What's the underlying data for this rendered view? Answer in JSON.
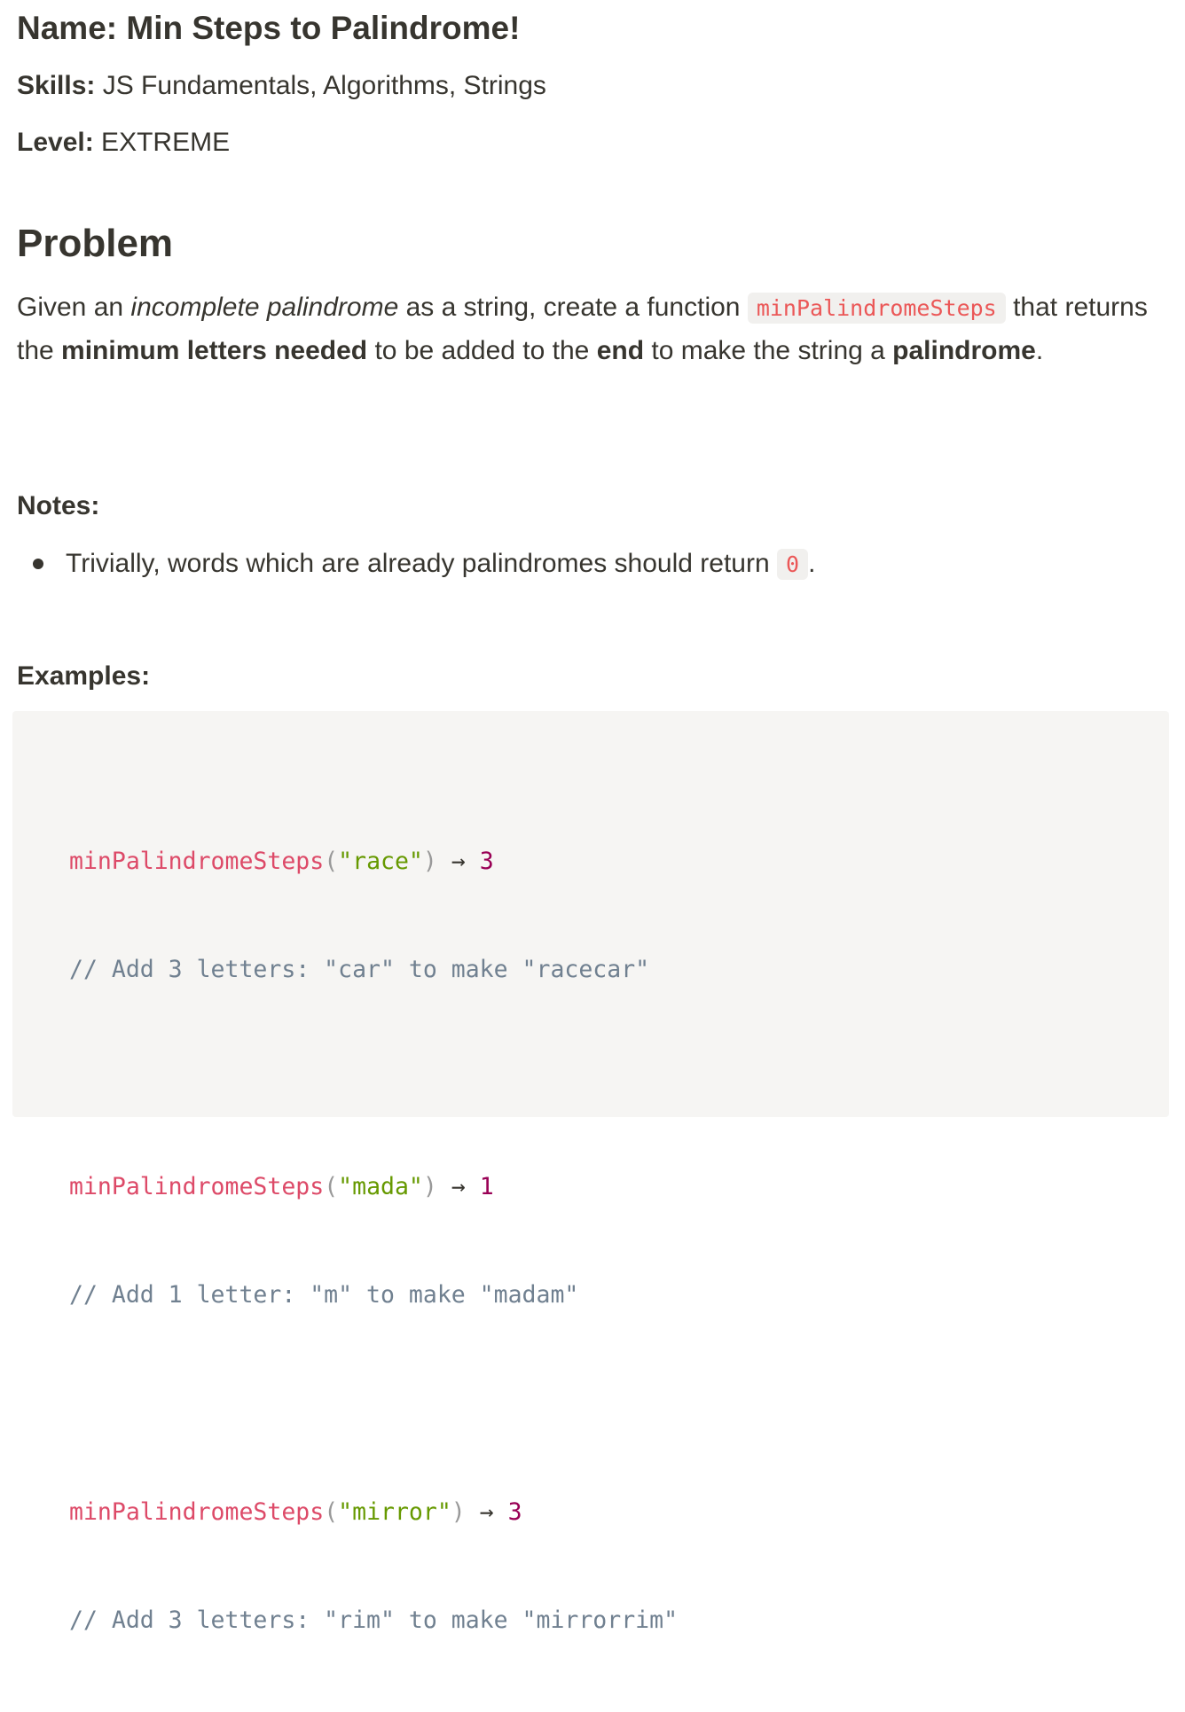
{
  "title": "Name: Min Steps to Palindrome!",
  "skills": {
    "label": "Skills:",
    "value": " JS Fundamentals, Algorithms, Strings"
  },
  "level": {
    "label": "Level:",
    "value": " EXTREME"
  },
  "problem": {
    "heading": "Problem",
    "seg1": "Given an ",
    "seg2_italic": "incomplete palindrome",
    "seg3": " as a string, create a function ",
    "seg4_code": "minPalindromeSteps",
    "seg5": " that returns the ",
    "seg6_bold": "minimum letters needed",
    "seg7": " to be added to the ",
    "seg8_bold": "end",
    "seg9": " to make the string a ",
    "seg10_bold": "palindrome",
    "seg11": "."
  },
  "notes": {
    "heading": "Notes:",
    "items": [
      {
        "text": "Trivially, words which are already palindromes should return ",
        "code": "0",
        "suffix": "."
      }
    ]
  },
  "examples": {
    "heading": "Examples:",
    "entries": [
      {
        "fn": "minPalindromeSteps",
        "open": "(",
        "arg": "\"race\"",
        "close": ")",
        "arrow": " → ",
        "result": "3",
        "comment": "// Add 3 letters: \"car\" to make \"racecar\""
      },
      {
        "fn": "minPalindromeSteps",
        "open": "(",
        "arg": "\"mada\"",
        "close": ")",
        "arrow": " → ",
        "result": "1",
        "comment": "// Add 1 letter: \"m\" to make \"madam\""
      },
      {
        "fn": "minPalindromeSteps",
        "open": "(",
        "arg": "\"mirror\"",
        "close": ")",
        "arrow": " → ",
        "result": "3",
        "comment": "// Add 3 letters: \"rim\" to make \"mirrorrim\""
      }
    ]
  },
  "colors": {
    "text": "#37352f",
    "inline_code_text": "#eb5757",
    "inline_code_bg": "#f1f0ee",
    "code_block_bg": "#f6f5f3",
    "syntax_function": "#dd4a68",
    "syntax_string": "#669900",
    "syntax_number": "#990055",
    "syntax_comment": "#708090",
    "syntax_punctuation": "#999999"
  }
}
